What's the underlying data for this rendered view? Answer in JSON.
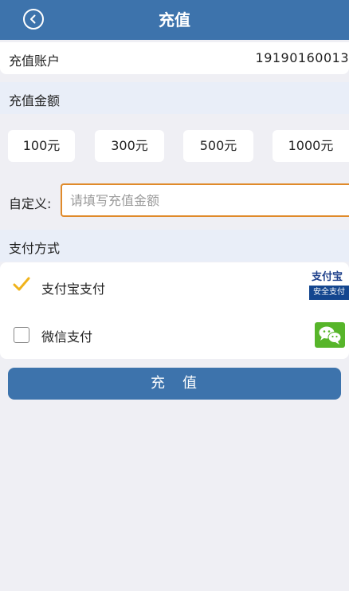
{
  "header": {
    "title": "充值"
  },
  "account": {
    "label": "充值账户",
    "value": "19190160013"
  },
  "amount_section": {
    "title": "充值金额",
    "options": [
      "100元",
      "300元",
      "500元",
      "1000元"
    ]
  },
  "custom": {
    "label": "自定义:",
    "placeholder": "请填写充值金额"
  },
  "payment_section": {
    "title": "支付方式",
    "methods": [
      {
        "label": "支付宝支付",
        "checked": true,
        "logo_top": "支付宝",
        "logo_bottom": "安全支付"
      },
      {
        "label": "微信支付",
        "checked": false
      }
    ]
  },
  "submit": {
    "label": "充　值"
  },
  "colors": {
    "primary": "#3d73ac",
    "check": "#f0b31c",
    "wechat": "#57b52a",
    "input_border": "#e08a2a"
  }
}
